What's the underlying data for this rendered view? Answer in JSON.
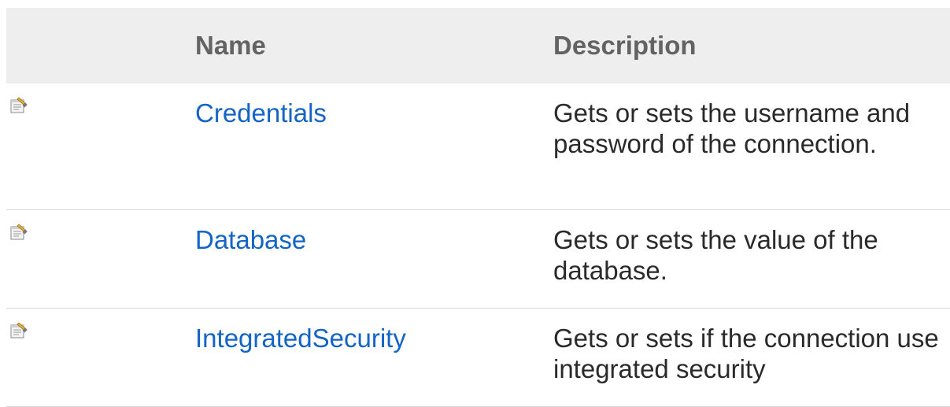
{
  "table": {
    "headers": {
      "icon": "",
      "name": "Name",
      "description": "Description"
    },
    "rows": [
      {
        "icon": "public-property-icon",
        "name": "Credentials",
        "description": "Gets or sets the username and password of the connection."
      },
      {
        "icon": "public-property-icon",
        "name": "Database",
        "description": "Gets or sets the value of the database."
      },
      {
        "icon": "public-property-icon",
        "name": "IntegratedSecurity",
        "description": "Gets or sets if the connection use integrated security"
      }
    ]
  },
  "colors": {
    "header_background": "#eeeeee",
    "header_text": "#636363",
    "link": "#1364c4",
    "body_text": "#2a2a2a",
    "row_divider": "#d8d8d8"
  }
}
